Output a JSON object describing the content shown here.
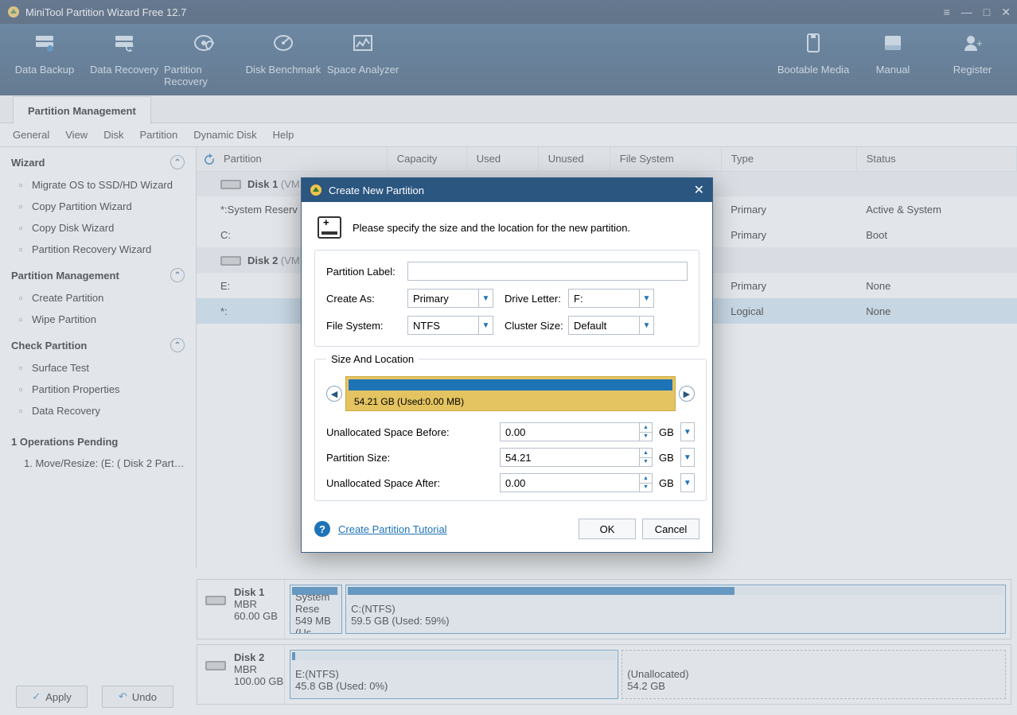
{
  "titlebar": {
    "title": "MiniTool Partition Wizard Free 12.7"
  },
  "toolbar": {
    "left": [
      {
        "name": "data-backup",
        "label": "Data Backup"
      },
      {
        "name": "data-recovery",
        "label": "Data Recovery"
      },
      {
        "name": "partition-recovery",
        "label": "Partition Recovery"
      },
      {
        "name": "disk-benchmark",
        "label": "Disk Benchmark"
      },
      {
        "name": "space-analyzer",
        "label": "Space Analyzer"
      }
    ],
    "right": [
      {
        "name": "bootable-media",
        "label": "Bootable Media"
      },
      {
        "name": "manual",
        "label": "Manual"
      },
      {
        "name": "register",
        "label": "Register"
      }
    ]
  },
  "tab": "Partition Management",
  "menubar": [
    "General",
    "View",
    "Disk",
    "Partition",
    "Dynamic Disk",
    "Help"
  ],
  "sidebar": {
    "groups": [
      {
        "title": "Wizard",
        "items": [
          "Migrate OS to SSD/HD Wizard",
          "Copy Partition Wizard",
          "Copy Disk Wizard",
          "Partition Recovery Wizard"
        ]
      },
      {
        "title": "Partition Management",
        "items": [
          "Create Partition",
          "Wipe Partition"
        ]
      },
      {
        "title": "Check Partition",
        "items": [
          "Surface Test",
          "Partition Properties",
          "Data Recovery"
        ]
      }
    ],
    "ops_header": "1 Operations Pending",
    "ops": [
      "1. Move/Resize: (E: ( Disk 2 Partiti..."
    ],
    "apply": "Apply",
    "undo": "Undo"
  },
  "table": {
    "headers": [
      "Partition",
      "Capacity",
      "Used",
      "Unused",
      "File System",
      "Type",
      "Status"
    ],
    "disks": [
      {
        "name": "Disk 1",
        "model": "(VM",
        "rows": [
          {
            "part": "*:System Reserv",
            "type": "Primary",
            "status": "Active & System"
          },
          {
            "part": "C:",
            "type": "Primary",
            "status": "Boot"
          }
        ]
      },
      {
        "name": "Disk 2",
        "model": "(VM",
        "rows": [
          {
            "part": "E:",
            "type": "Primary",
            "status": "None"
          },
          {
            "part": "*:",
            "type": "Logical",
            "status": "None",
            "hl": true
          }
        ]
      }
    ]
  },
  "bottom": {
    "disks": [
      {
        "name": "Disk 1",
        "style": "MBR",
        "size": "60.00 GB",
        "parts": [
          {
            "label": "System Rese",
            "sub": "549 MB (Us",
            "pct": 6,
            "used": 95
          },
          {
            "label": "C:(NTFS)",
            "sub": "59.5 GB (Used: 59%)",
            "pct": 94,
            "used": 59
          }
        ]
      },
      {
        "name": "Disk 2",
        "style": "MBR",
        "size": "100.00 GB",
        "parts": [
          {
            "label": "E:(NTFS)",
            "sub": "45.8 GB (Used: 0%)",
            "pct": 46,
            "used": 1
          },
          {
            "label": "(Unallocated)",
            "sub": "54.2 GB",
            "pct": 54,
            "unalloc": true
          }
        ]
      }
    ]
  },
  "dialog": {
    "title": "Create New Partition",
    "desc": "Please specify the size and the location for the new partition.",
    "label_partition_label": "Partition Label:",
    "partition_label_value": "",
    "label_create_as": "Create As:",
    "create_as_value": "Primary",
    "label_drive_letter": "Drive Letter:",
    "drive_letter_value": "F:",
    "label_file_system": "File System:",
    "file_system_value": "NTFS",
    "label_cluster_size": "Cluster Size:",
    "cluster_size_value": "Default",
    "sizeloc_legend": "Size And Location",
    "slider_label": "54.21 GB (Used:0.00 MB)",
    "label_space_before": "Unallocated Space Before:",
    "space_before_value": "0.00",
    "label_partition_size": "Partition Size:",
    "partition_size_value": "54.21",
    "label_space_after": "Unallocated Space After:",
    "space_after_value": "0.00",
    "unit": "GB",
    "tutorial": "Create Partition Tutorial",
    "ok": "OK",
    "cancel": "Cancel"
  }
}
